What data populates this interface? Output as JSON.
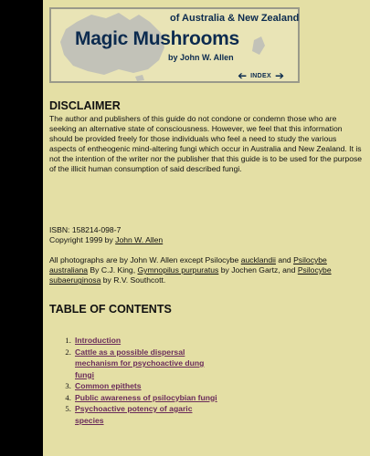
{
  "banner": {
    "subtitle": "of Australia & New Zealand",
    "title": "Magic Mushrooms",
    "author": "by John W. Allen",
    "nav_prev_icon": "left-arrow",
    "nav_label": "INDEX",
    "nav_next_icon": "right-arrow",
    "map_color": "#c2c2b8",
    "text_color": "#0c2b4f"
  },
  "disclaimer": {
    "heading": "DISCLAIMER",
    "text": "The author and publishers of this guide do not condone or condemn those who are seeking an alternative state of consciousness. However, we feel that this information should be provided freely for those individuals who feel a need to study the various aspects of entheogenic mind-altering fungi which occur in Australia and New Zealand. It is not the intention of the writer nor the publisher that this guide is to be used for the purpose of the illicit human consumption of said described fungi."
  },
  "publication": {
    "isbn": "ISBN: 158214-098-7",
    "copyright_prefix": "Copyright 1999 by ",
    "copyright_link": "John W. Allen"
  },
  "photos": {
    "t1": "All photographs are by John W. Allen except Psilocybe ",
    "l1": "aucklandii",
    "t2": " and ",
    "l2": "Psilocybe australiana",
    "t3": " By C.J. King, ",
    "l3": "Gymnopilus purpuratus",
    "t4": " by Jochen Gartz, and ",
    "l4": "Psilocybe subaeruginosa",
    "t5": " by R.V. Southcott."
  },
  "toc": {
    "heading": "TABLE OF CONTENTS",
    "items": [
      {
        "label": "Introduction"
      },
      {
        "label": "Cattle as a possible dispersal mechanism for psychoactive dung fungi"
      },
      {
        "label": "Common epithets"
      },
      {
        "label": "Public awareness of psilocybian fungi"
      },
      {
        "label": "Psychoactive potency of agaric species"
      }
    ],
    "link_color": "#6a2b5a"
  },
  "colors": {
    "background": "#e4dfa5",
    "sidebar": "#000000"
  }
}
